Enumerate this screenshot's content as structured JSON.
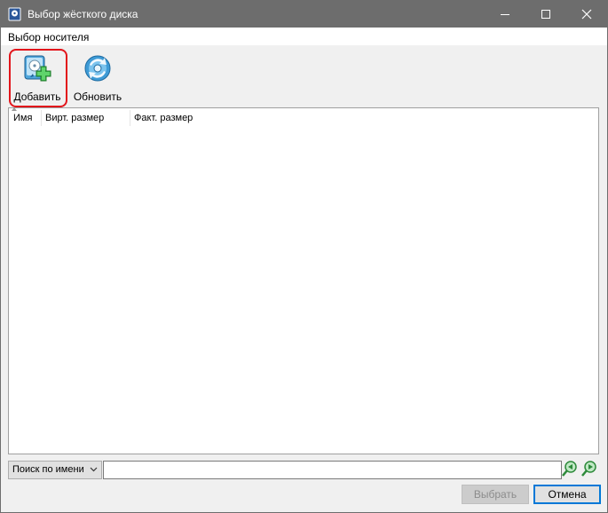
{
  "window": {
    "title": "Выбор жёсткого диска",
    "app_icon": "virtualbox-disk-icon",
    "controls": [
      "minimize-icon",
      "maximize-icon",
      "close-icon"
    ]
  },
  "menubar": {
    "items": [
      "Выбор носителя"
    ]
  },
  "toolbar": {
    "add_label": "Добавить",
    "add_icon": "add-disk-icon",
    "refresh_label": "Обновить",
    "refresh_icon": "refresh-disk-icon",
    "highlight_color": "#e2151b"
  },
  "list": {
    "columns": [
      "Имя",
      "Вирт. размер",
      "Факт. размер"
    ],
    "rows": []
  },
  "bottom": {
    "search_mode": "Поиск по имени",
    "search_value": "",
    "search_prev_icon": "search-previous-icon",
    "search_next_icon": "search-next-icon",
    "choose_label": "Выбрать",
    "cancel_label": "Отмена"
  }
}
